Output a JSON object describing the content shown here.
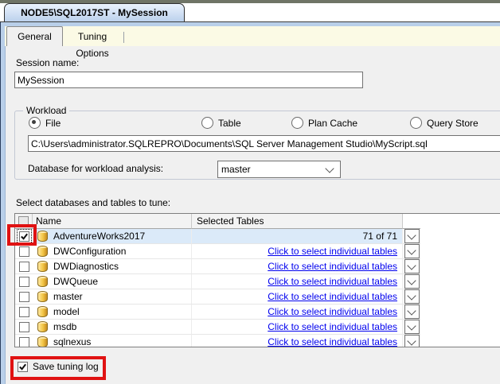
{
  "window": {
    "title": "NODE5\\SQL2017ST - MySession"
  },
  "tabs": [
    {
      "label": "General",
      "active": true
    },
    {
      "label": "Tuning Options",
      "active": false
    }
  ],
  "general": {
    "session_name_label": "Session name:",
    "session_name_value": "MySession",
    "workload": {
      "group_label": "Workload",
      "options": [
        {
          "label": "File",
          "selected": true
        },
        {
          "label": "Table",
          "selected": false
        },
        {
          "label": "Plan Cache",
          "selected": false
        },
        {
          "label": "Query Store",
          "selected": false
        }
      ],
      "file_path": "C:\\Users\\administrator.SQLREPRO\\Documents\\SQL Server Management Studio\\MyScript.sql",
      "database_label": "Database for workload analysis:",
      "database_value": "master"
    },
    "table_section": {
      "label": "Select databases and tables to tune:",
      "columns": [
        "Name",
        "Selected Tables"
      ],
      "rows": [
        {
          "name": "AdventureWorks2017",
          "checked": true,
          "highlighted": true,
          "selected_tables": "71 of 71",
          "is_link": false
        },
        {
          "name": "DWConfiguration",
          "checked": false,
          "highlighted": false,
          "selected_tables": "Click to select individual tables",
          "is_link": true
        },
        {
          "name": "DWDiagnostics",
          "checked": false,
          "highlighted": false,
          "selected_tables": "Click to select individual tables",
          "is_link": true
        },
        {
          "name": "DWQueue",
          "checked": false,
          "highlighted": false,
          "selected_tables": "Click to select individual tables",
          "is_link": true
        },
        {
          "name": "master",
          "checked": false,
          "highlighted": false,
          "selected_tables": "Click to select individual tables",
          "is_link": true
        },
        {
          "name": "model",
          "checked": false,
          "highlighted": false,
          "selected_tables": "Click to select individual tables",
          "is_link": true
        },
        {
          "name": "msdb",
          "checked": false,
          "highlighted": false,
          "selected_tables": "Click to select individual tables",
          "is_link": true
        },
        {
          "name": "sqlnexus",
          "checked": false,
          "highlighted": false,
          "selected_tables": "Click to select individual tables",
          "is_link": true
        }
      ]
    },
    "save_tuning_log": {
      "label": "Save tuning log",
      "checked": true
    }
  },
  "annotations": {
    "highlight_color": "#e01212"
  }
}
